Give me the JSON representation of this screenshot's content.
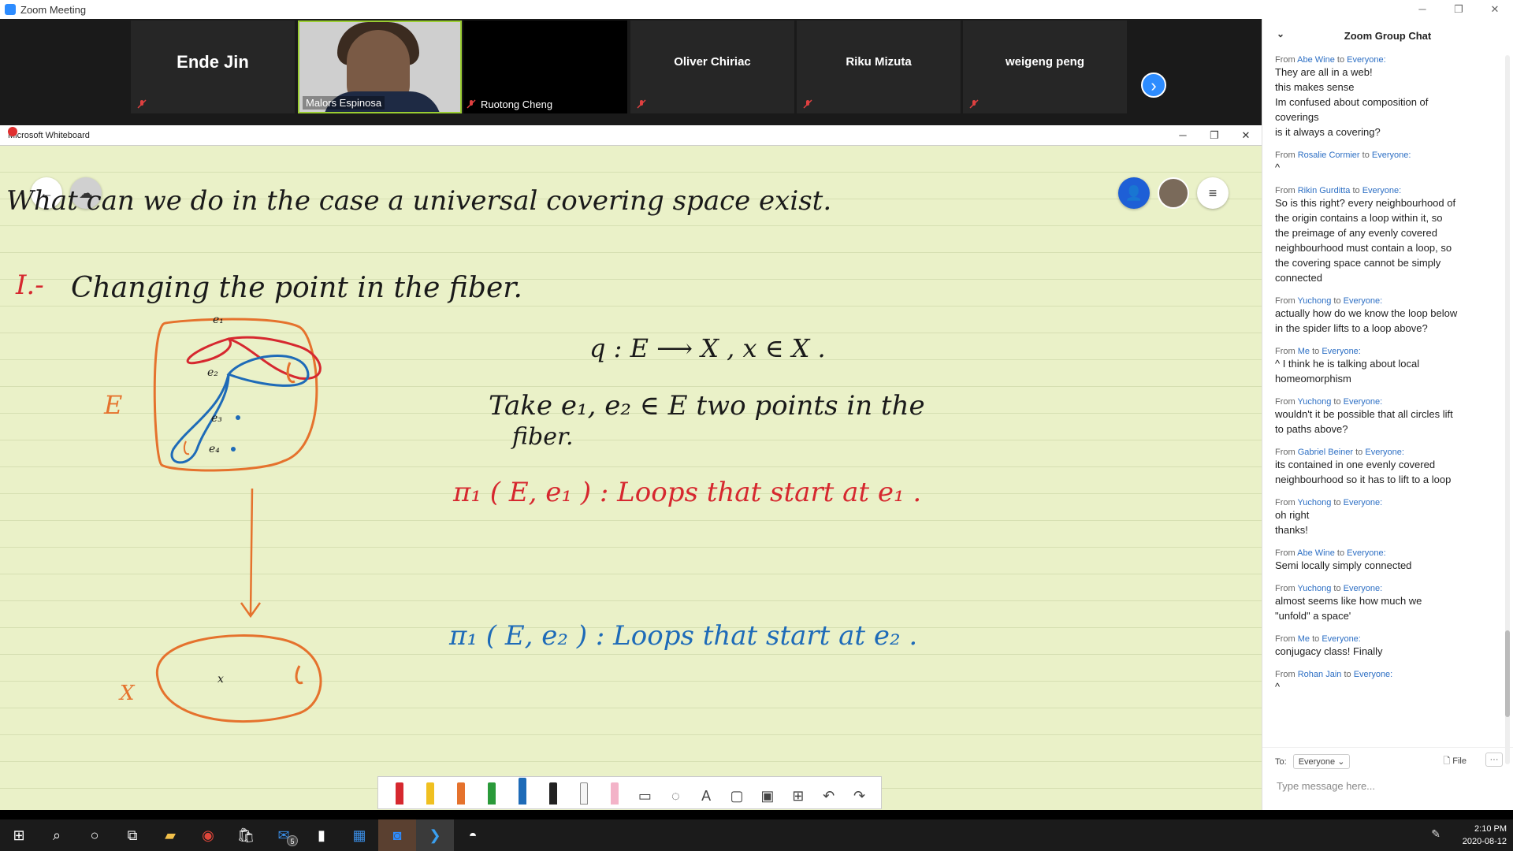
{
  "zoom": {
    "window_title": "Zoom Meeting"
  },
  "participants": [
    {
      "name": "Ende Jin",
      "video": false
    },
    {
      "name": "Malors Espinosa",
      "video": true
    },
    {
      "name": "Ruotong Cheng",
      "video": false
    },
    {
      "name": "Oliver Chiriac",
      "video": false
    },
    {
      "name": "Riku Mizuta",
      "video": false
    },
    {
      "name": "weigeng peng",
      "video": false
    }
  ],
  "whiteboard": {
    "window_title": "Microsoft Whiteboard",
    "lines": {
      "q1": "What can we do in the case a universal covering space exist.",
      "h1_num": "I.-",
      "h1_text": "Changing the point in the fiber.",
      "map": "q : E ⟶ X ,  x ∈ X .",
      "take1": "Take  e₁, e₂ ∈ E  two  points  in  the",
      "take2": "fiber.",
      "pi1": "π₁ ( E, e₁ ) :   Loops   that  start   at   e₁ .",
      "pi2": "π₁ ( E, e₂ ) :   Loops   that  start   at   e₂ .",
      "E_label": "E",
      "X_label": "X",
      "e1": "e₁",
      "e2": "e₂",
      "e3": "e₃",
      "e4": "e₄",
      "x": "x"
    },
    "toolbar": [
      "red-pen",
      "yellow-pen",
      "orange-pen",
      "green-pen",
      "blue-pen",
      "black-pen",
      "highlighter",
      "eraser",
      "ruler",
      "lasso",
      "text",
      "shape",
      "image",
      "insert",
      "undo",
      "redo"
    ]
  },
  "chat": {
    "title": "Zoom Group Chat",
    "messages": [
      {
        "from": "Abe Wine",
        "to": "Everyone:",
        "lines": [
          "They are all in a web!",
          "this makes sense",
          "Im confused about composition of",
          "coverings",
          "is it always a covering?"
        ]
      },
      {
        "from": "Rosalie Cormier",
        "to": "Everyone:",
        "lines": [
          "^"
        ]
      },
      {
        "from": "Rikin Gurditta",
        "to": "Everyone:",
        "lines": [
          "So is this right? every neighbourhood of",
          "the origin contains a loop within it, so",
          "the preimage of any evenly covered",
          "neighbourhood must contain a loop, so",
          "the covering space cannot be simply",
          "connected"
        ]
      },
      {
        "from": "Yuchong",
        "to": "Everyone:",
        "lines": [
          "actually how do we know the loop below",
          "in the spider lifts to a loop above?"
        ]
      },
      {
        "from": "Me",
        "to": "Everyone:",
        "lines": [
          "^ I think he is talking about local",
          "homeomorphism"
        ]
      },
      {
        "from": "Yuchong",
        "to": "Everyone:",
        "lines": [
          "wouldn't it be possible that all circles lift",
          "to paths above?"
        ]
      },
      {
        "from": "Gabriel Beiner",
        "to": "Everyone:",
        "lines": [
          "its contained in one evenly covered",
          "neighbourhood so it has to lift to a loop"
        ]
      },
      {
        "from": "Yuchong",
        "to": "Everyone:",
        "lines": [
          "oh right",
          "thanks!"
        ]
      },
      {
        "from": "Abe Wine",
        "to": "Everyone:",
        "lines": [
          "Semi locally simply connected"
        ]
      },
      {
        "from": "Yuchong",
        "to": "Everyone:",
        "lines": [
          "almost seems like how much we",
          "\"unfold\" a space'"
        ]
      },
      {
        "from": "Me",
        "to": "Everyone:",
        "lines": [
          "conjugacy class! Finally"
        ]
      },
      {
        "from": "Rohan Jain",
        "to": "Everyone:",
        "lines": [
          "^"
        ]
      }
    ],
    "from_prefix": "From",
    "to_word": "to",
    "to_label": "To:",
    "to_value": "Everyone",
    "file_label": "File",
    "more_label": "···",
    "input_placeholder": "Type message here..."
  },
  "taskbar": {
    "mail_badge": "5",
    "time": "2:10 PM",
    "date": "2020-08-12"
  }
}
